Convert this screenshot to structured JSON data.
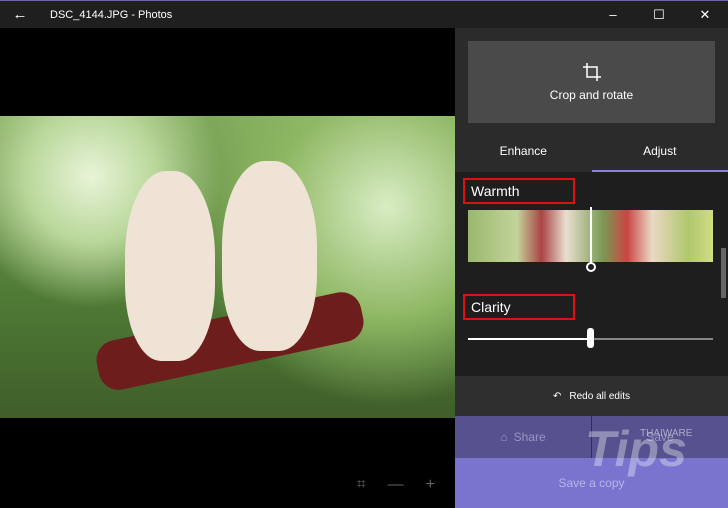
{
  "titlebar": {
    "title": "DSC_4144.JPG - Photos",
    "back": "←",
    "minimize": "–",
    "maximize": "☐",
    "close": "✕"
  },
  "viewer": {
    "fit_icon": "⌗",
    "zoom_out": "—",
    "zoom_in": "+"
  },
  "panel": {
    "crop_label": "Crop and rotate",
    "tabs": [
      {
        "label": "Enhance"
      },
      {
        "label": "Adjust"
      }
    ],
    "warmth_label": "Warmth",
    "clarity_label": "Clarity",
    "clarity_value": 0.5,
    "redo_label": "Redo all edits",
    "share_label": "Share",
    "save_label": "Save",
    "save_copy_label": "Save a copy"
  },
  "watermark": {
    "logo": "Tips",
    "brand": "THAIWARE"
  }
}
